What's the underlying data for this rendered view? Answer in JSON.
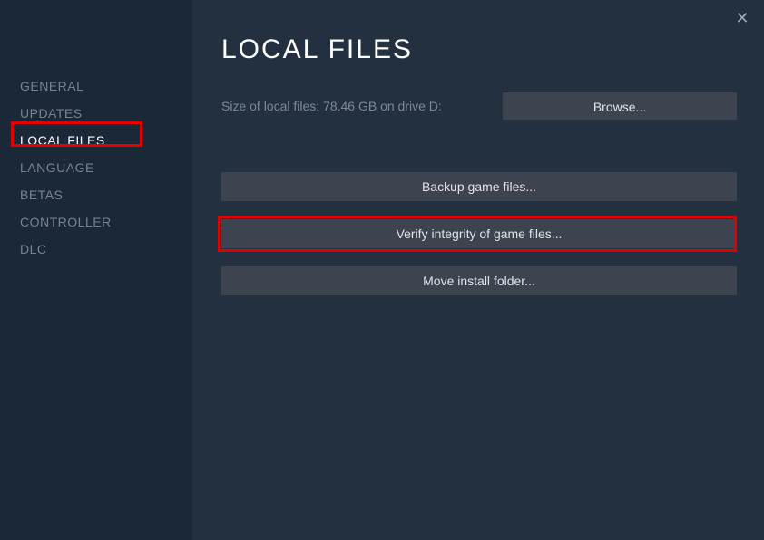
{
  "sidebar": {
    "items": [
      {
        "label": "GENERAL",
        "active": false
      },
      {
        "label": "UPDATES",
        "active": false
      },
      {
        "label": "LOCAL FILES",
        "active": true
      },
      {
        "label": "LANGUAGE",
        "active": false
      },
      {
        "label": "BETAS",
        "active": false
      },
      {
        "label": "CONTROLLER",
        "active": false
      },
      {
        "label": "DLC",
        "active": false
      }
    ]
  },
  "main": {
    "title": "LOCAL FILES",
    "size_text": "Size of local files: 78.46 GB on drive D:",
    "browse_label": "Browse...",
    "backup_label": "Backup game files...",
    "verify_label": "Verify integrity of game files...",
    "move_label": "Move install folder..."
  }
}
